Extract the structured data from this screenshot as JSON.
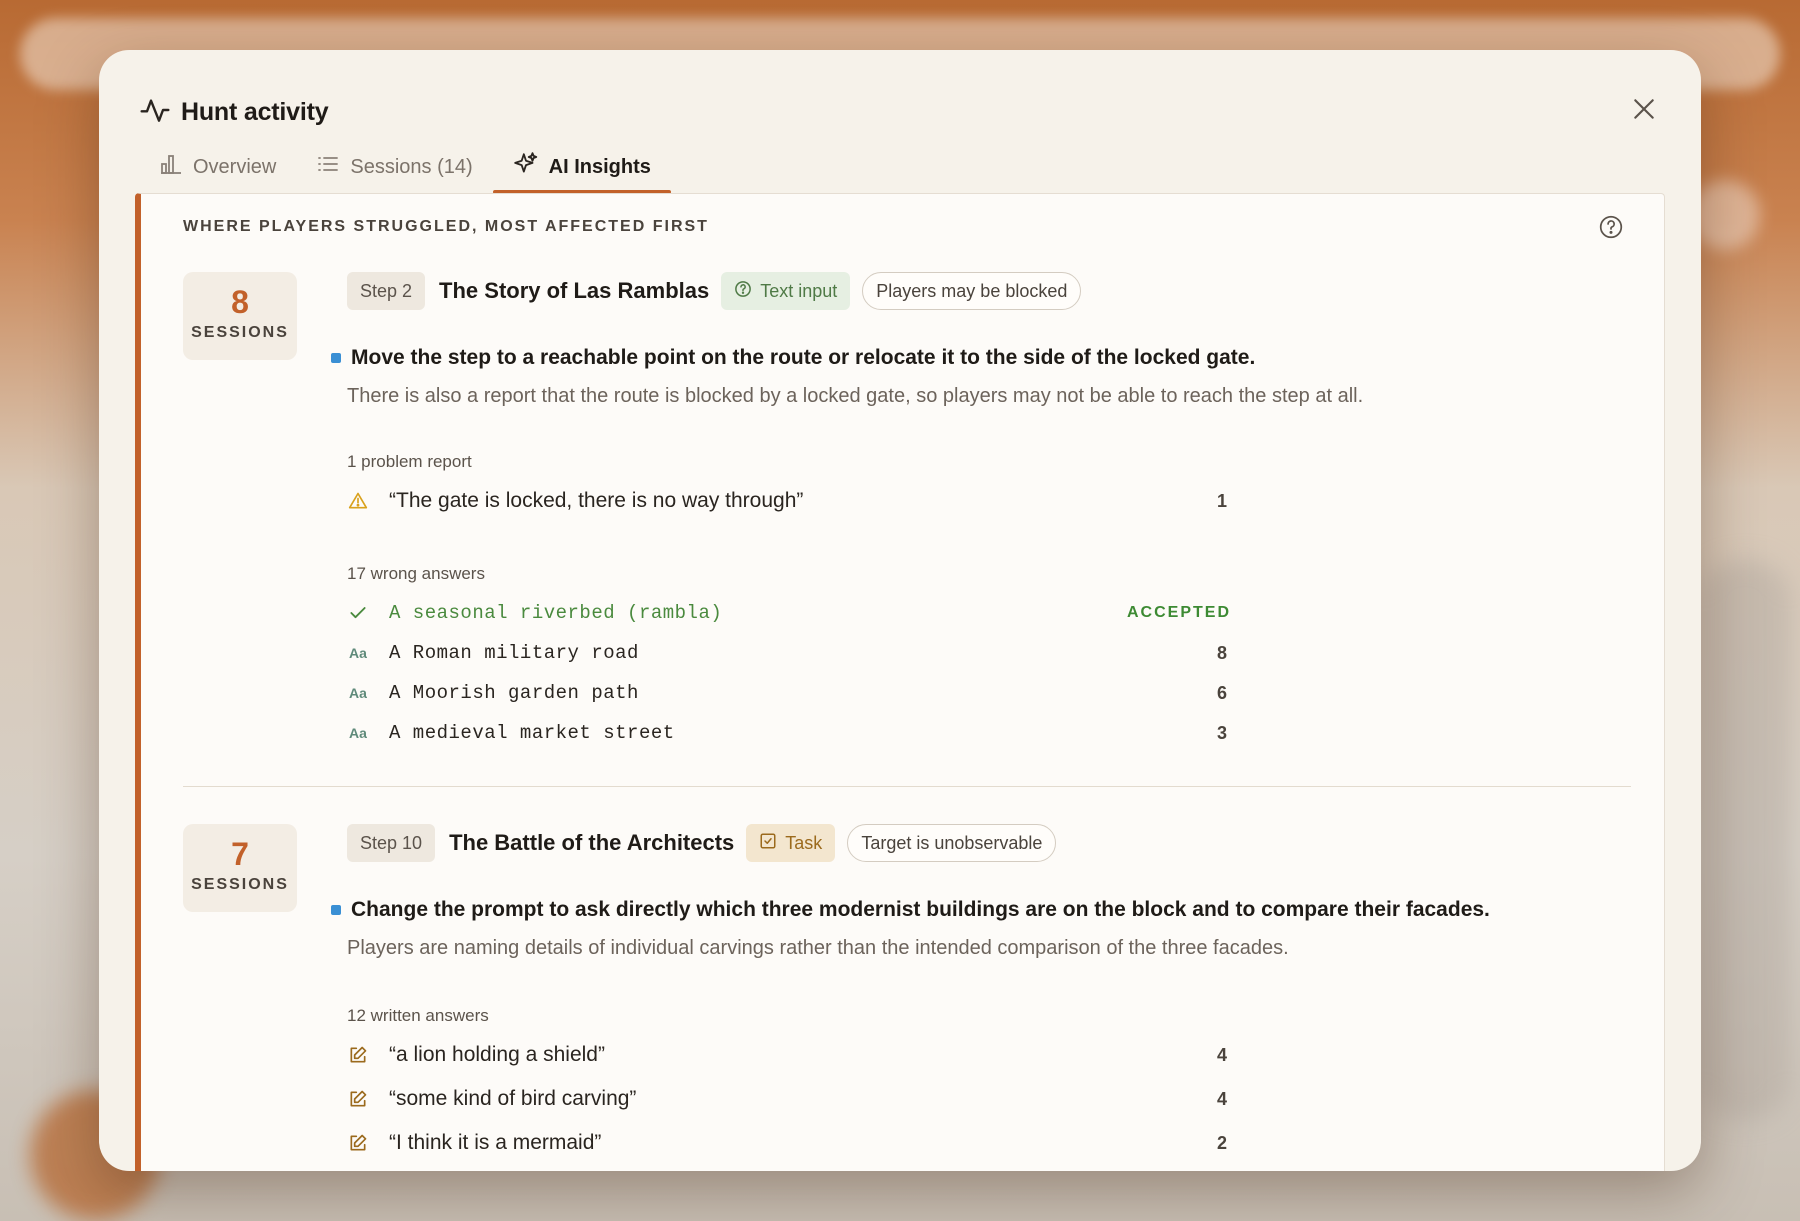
{
  "modal": {
    "title": "Hunt activity",
    "tabs": [
      {
        "label": "Overview",
        "icon": "bar-chart-icon",
        "active": false
      },
      {
        "label": "Sessions (14)",
        "icon": "list-icon",
        "active": false
      },
      {
        "label": "AI Insights",
        "icon": "sparkles-icon",
        "active": true
      }
    ]
  },
  "panel": {
    "heading": "WHERE PLAYERS STRUGGLED, MOST AFFECTED FIRST",
    "insights": [
      {
        "sessions": "8",
        "sessions_label": "SESSIONS",
        "step": "Step 2",
        "title": "The Story of Las Ramblas",
        "type": "Text input",
        "flag": "Players may be blocked",
        "recommendation": "Move the step to a reachable point on the route or relocate it to the side of the locked gate.",
        "description": "There is also a report that the route is blocked by a locked gate, so players may not be able to reach the step at all.",
        "problem_label": "1 problem report",
        "problems": [
          {
            "text": "“The gate is locked, there is no way through”",
            "count": "1"
          }
        ],
        "answers_label": "17 wrong answers",
        "answers": [
          {
            "text": "A seasonal riverbed (rambla)",
            "count": "ACCEPTED",
            "accepted": true
          },
          {
            "text": "A Roman military road",
            "count": "8"
          },
          {
            "text": "A Moorish garden path",
            "count": "6"
          },
          {
            "text": "A medieval market street",
            "count": "3"
          }
        ]
      },
      {
        "sessions": "7",
        "sessions_label": "SESSIONS",
        "step": "Step 10",
        "title": "The Battle of the Architects",
        "type": "Task",
        "flag": "Target is unobservable",
        "recommendation": "Change the prompt to ask directly which three modernist buildings are on the block and to compare their facades.",
        "description": "Players are naming details of individual carvings rather than the intended comparison of the three facades.",
        "answers_label": "12 written answers",
        "answers": [
          {
            "text": "“a lion holding a shield”",
            "count": "4"
          },
          {
            "text": "“some kind of bird carving”",
            "count": "4"
          },
          {
            "text": "“I think it is a mermaid”",
            "count": "2"
          }
        ]
      }
    ]
  },
  "icons": {
    "activity": "activity-icon",
    "close": "close-icon",
    "help": "help-circle-icon",
    "warning": "warning-icon",
    "check": "check-icon",
    "text_answer": "text-format-icon",
    "written_answer": "edit-icon"
  },
  "colors": {
    "accent": "#c2612a",
    "recommendation_dot": "#3a8fd4",
    "accepted": "#3d8a33",
    "warning": "#d9a11c"
  }
}
